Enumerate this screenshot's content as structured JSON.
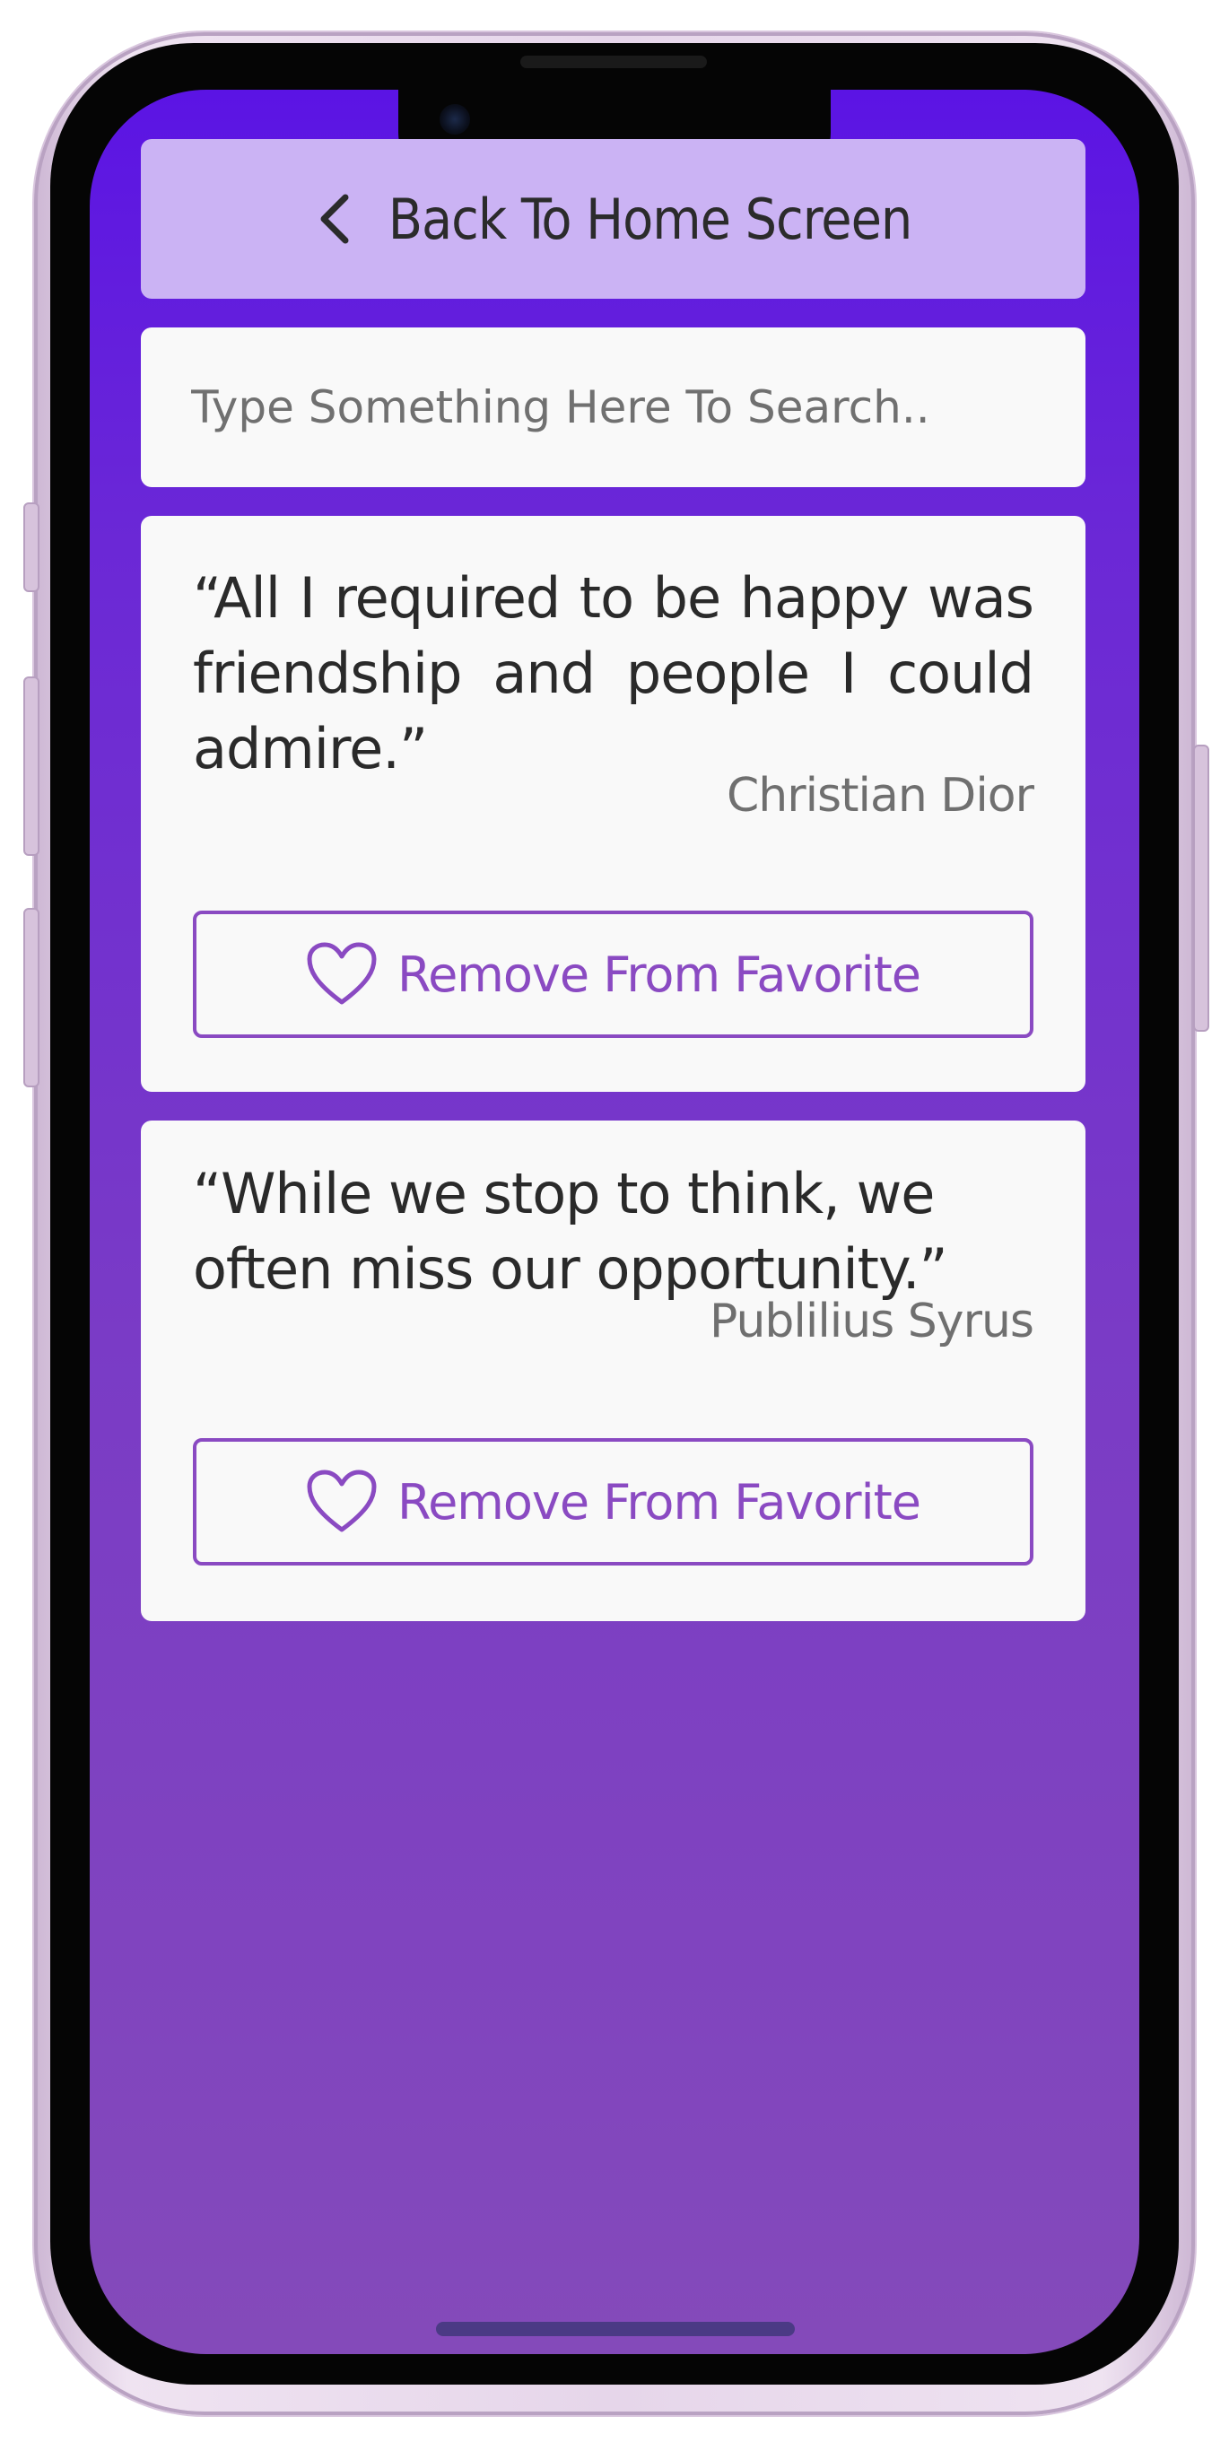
{
  "header": {
    "back_label": "Back To Home Screen"
  },
  "search": {
    "placeholder": "Type Something Here To Search.."
  },
  "favorites": [
    {
      "quote": "“All I required to be happy was friendship and people I could admire.”",
      "author": "Christian Dior",
      "button_label": "Remove From Favorite"
    },
    {
      "quote": "“While we stop to think, we often miss our opportunity.”",
      "author": "Publilius Syrus",
      "button_label": "Remove From Favorite"
    }
  ],
  "colors": {
    "background_top": "#5b14e4",
    "background_bottom": "#844aba",
    "header_bg": "#cbb3f4",
    "card_bg": "#f9f9f9",
    "accent": "#8a4ac2",
    "text": "#2a2a2a",
    "author_text": "#6f6f6f"
  },
  "icons": {
    "back": "chevron-left-icon",
    "favorite": "heart-icon"
  }
}
